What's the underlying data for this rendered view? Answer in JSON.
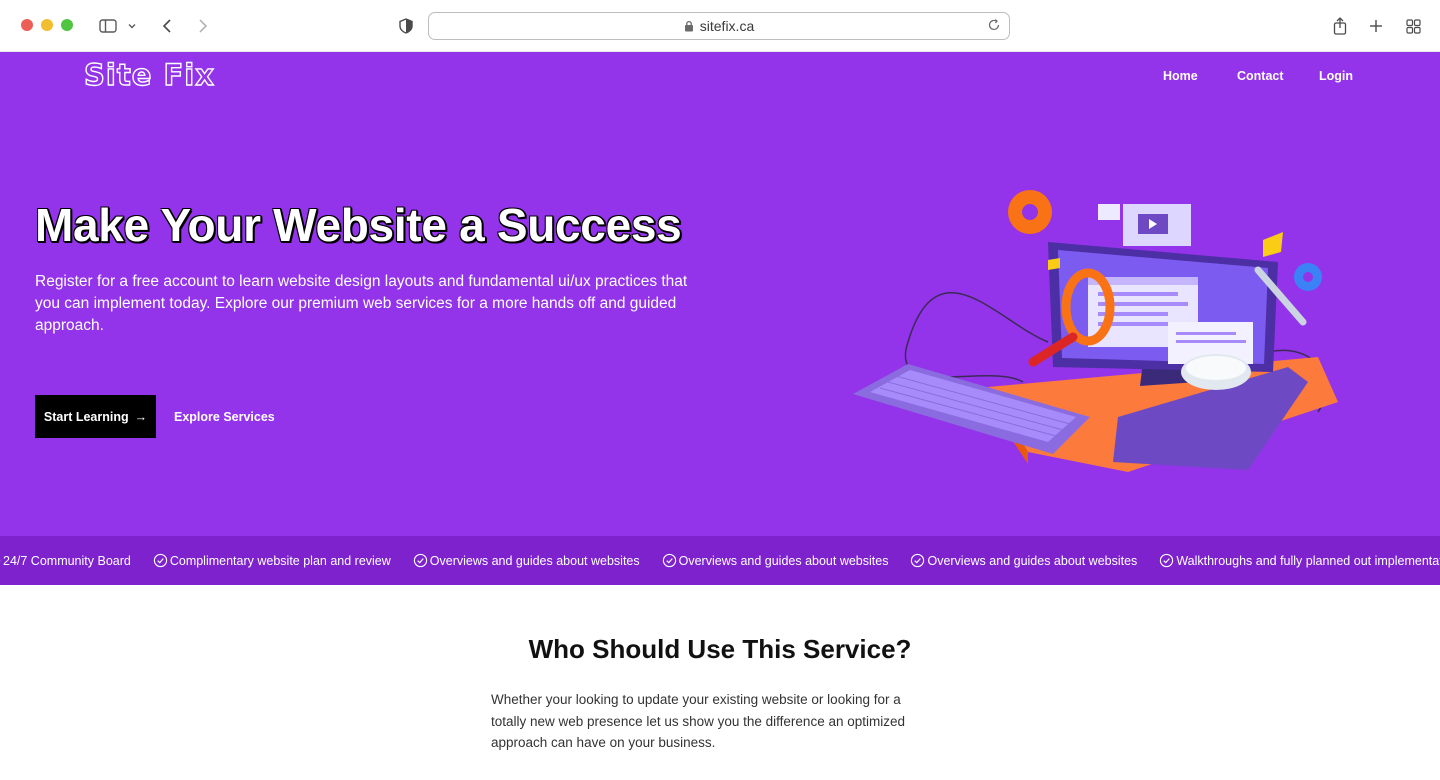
{
  "browser": {
    "url": "sitefix.ca"
  },
  "site": {
    "logo": "Site Fix",
    "nav": [
      "Home",
      "Contact",
      "Login"
    ]
  },
  "hero": {
    "title": "Make Your Website a Success",
    "text": "Register for a free account to learn website design layouts and fundamental ui/ux practices that you can implement today. Explore our premium web services for a more hands off and guided approach.",
    "primary_button": "Start Learning",
    "primary_arrow": "→",
    "secondary_button": "Explore Services",
    "background_color": "#9333ea"
  },
  "ticker": {
    "background_color": "#7e22ce",
    "items": [
      "24/7 Community Board",
      "Complimentary website plan and review",
      "Overviews and guides about websites",
      "Overviews and guides about websites",
      "Overviews and guides about websites",
      "Walkthroughs and fully planned out implementations"
    ]
  },
  "section": {
    "title": "Who Should Use This Service?",
    "text": "Whether your looking to update your existing website or looking for a totally new web presence let us show you the difference an optimized approach can have on your business."
  }
}
